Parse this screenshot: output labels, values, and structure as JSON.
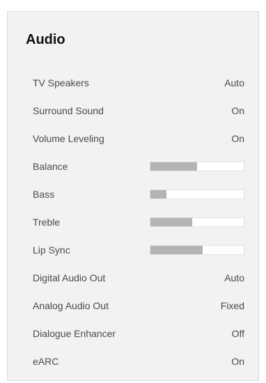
{
  "menu": {
    "title": "Audio",
    "rows": [
      {
        "label": "TV Speakers",
        "value": "Auto"
      },
      {
        "label": "Surround Sound",
        "value": "On"
      },
      {
        "label": "Volume Leveling",
        "value": "On"
      },
      {
        "label": "Balance",
        "level": 0.5
      },
      {
        "label": "Bass",
        "level": 0.17
      },
      {
        "label": "Treble",
        "level": 0.45
      },
      {
        "label": "Lip Sync",
        "level": 0.56
      },
      {
        "label": "Digital Audio Out",
        "value": "Auto"
      },
      {
        "label": "Analog Audio Out",
        "value": "Fixed"
      },
      {
        "label": "Dialogue Enhancer",
        "value": "Off"
      },
      {
        "label": "eARC",
        "value": "On"
      }
    ]
  },
  "colors": {
    "panel_background": "#f2f2f2",
    "slider_fill": "#b3b3b3",
    "slider_track": "#ffffff"
  }
}
